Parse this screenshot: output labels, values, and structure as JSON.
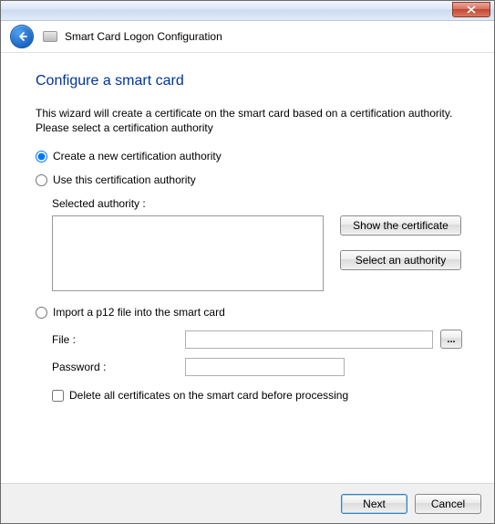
{
  "window": {
    "title": "Smart Card Logon Configuration"
  },
  "page": {
    "heading": "Configure a smart card",
    "intro": "This wizard will create a certificate on the smart card based on a certification authority. Please select a certification authority"
  },
  "options": {
    "create_new": "Create a new certification authority",
    "use_existing": "Use this certification authority",
    "import_p12": "Import a p12 file into the smart card"
  },
  "authority": {
    "label": "Selected authority :",
    "value": "",
    "show_btn": "Show the certificate",
    "select_btn": "Select an authority"
  },
  "file_section": {
    "file_label": "File :",
    "file_value": "",
    "browse_label": "...",
    "password_label": "Password :",
    "password_value": ""
  },
  "delete_check": {
    "label": "Delete all certificates on the smart card before processing"
  },
  "footer": {
    "next": "Next",
    "cancel": "Cancel"
  }
}
